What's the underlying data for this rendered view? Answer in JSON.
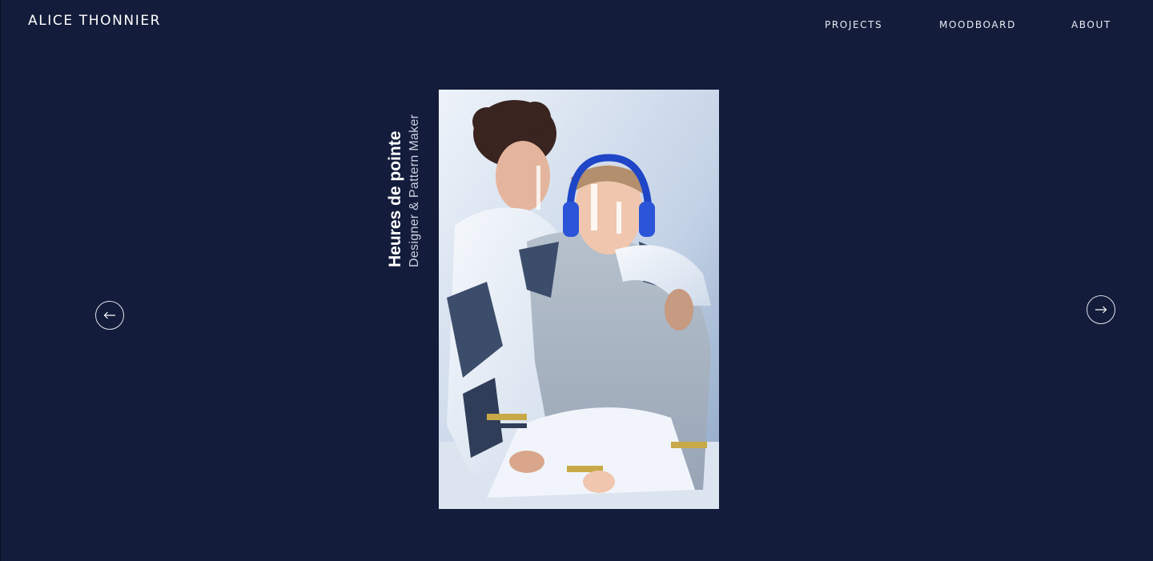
{
  "header": {
    "logo": "ALICE THONNIER",
    "nav": [
      {
        "label": "PROJECTS"
      },
      {
        "label": "MOODBOARD"
      },
      {
        "label": "ABOUT"
      }
    ]
  },
  "slide": {
    "title": "Heures de pointe",
    "subtitle": "Designer & Pattern Maker",
    "image_icon": "fashion-photo"
  },
  "controls": {
    "prev_icon": "arrow-left-icon",
    "next_icon": "arrow-right-icon"
  },
  "colors": {
    "background": "#131c3a",
    "text": "#ffffff"
  }
}
